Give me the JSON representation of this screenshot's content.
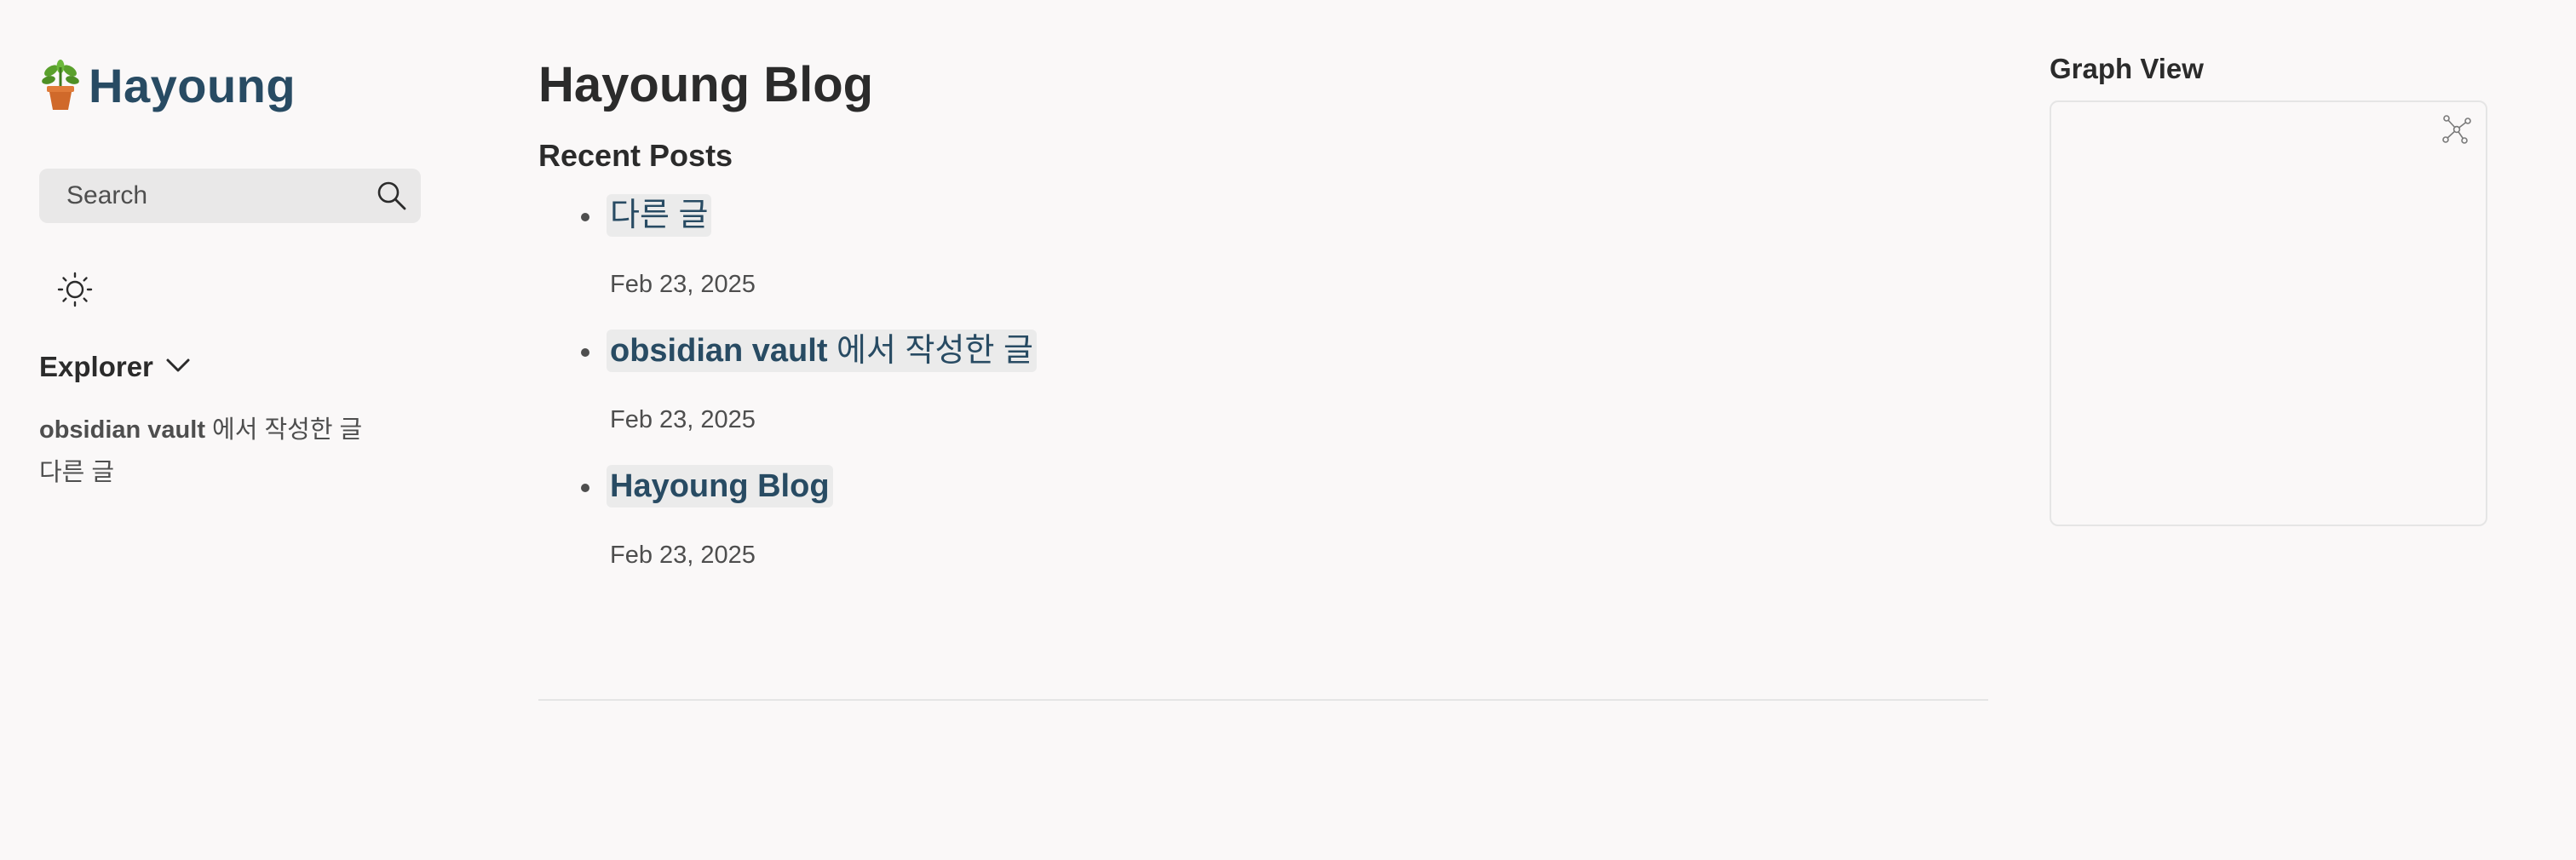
{
  "sidebar": {
    "brand_icon": "potted-plant-icon",
    "brand_title": "Hayoung",
    "search": {
      "label": "Search",
      "icon": "search-icon"
    },
    "theme_toggle_icon": "sun-icon",
    "explorer": {
      "title": "Explorer",
      "toggle_icon": "chevron-down-icon",
      "items": [
        {
          "bold": "obsidian vault",
          "rest": " 에서 작성한 글"
        },
        {
          "bold": "",
          "rest": "다른 글"
        }
      ]
    }
  },
  "main": {
    "title": "Hayoung Blog",
    "recent_posts_title": "Recent Posts",
    "posts": [
      {
        "bold": "",
        "rest": "다른 글",
        "date": "Feb 23, 2025"
      },
      {
        "bold": "obsidian vault",
        "rest": " 에서 작성한 글",
        "date": "Feb 23, 2025"
      },
      {
        "bold": "Hayoung Blog",
        "rest": "",
        "date": "Feb 23, 2025"
      }
    ]
  },
  "right": {
    "graph_title": "Graph View",
    "global_graph_icon": "graph-network-icon"
  },
  "colors": {
    "background": "#faf8f8",
    "brand": "#284b63",
    "text": "#2b2b2b",
    "muted_text": "#4e4e4e",
    "highlight": "#ebebeb",
    "border": "#e5e5e5"
  }
}
